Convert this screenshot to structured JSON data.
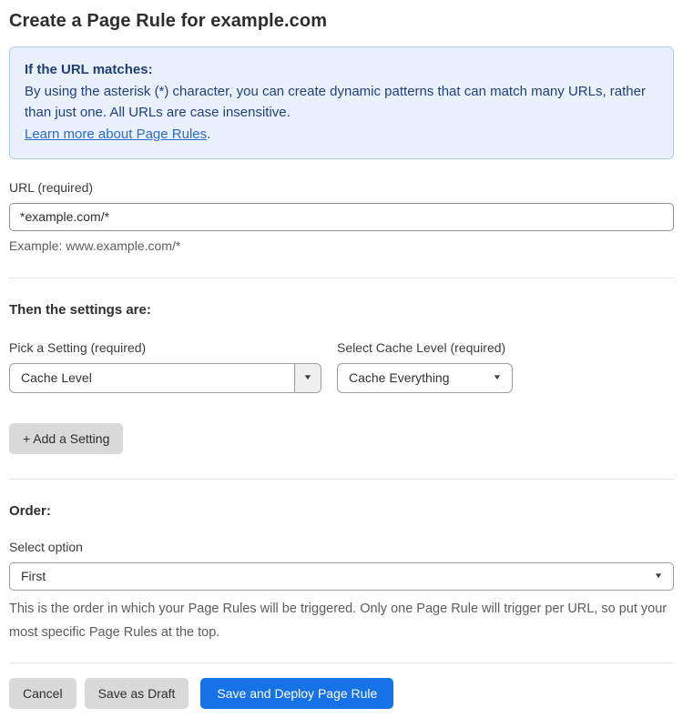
{
  "page": {
    "title": "Create a Page Rule for example.com"
  },
  "info_box": {
    "heading": "If the URL matches:",
    "body": "By using the asterisk (*) character, you can create dynamic patterns that can match many URLs, rather than just one. All URLs are case insensitive.",
    "link_label": "Learn more about Page Rules",
    "link_suffix": "."
  },
  "url_field": {
    "label": "URL (required)",
    "value": "*example.com/*",
    "helper": "Example: www.example.com/*"
  },
  "settings": {
    "heading": "Then the settings are:",
    "setting_picker": {
      "label": "Pick a Setting (required)",
      "selected": "Cache Level"
    },
    "cache_level_picker": {
      "label": "Select Cache Level (required)",
      "selected": "Cache Everything"
    },
    "add_setting_label": "+ Add a Setting"
  },
  "order": {
    "heading": "Order:",
    "select_label": "Select option",
    "selected": "First",
    "helper": "This is the order in which your Page Rules will be triggered. Only one Page Rule will trigger per URL, so put your most specific Page Rules at the top."
  },
  "actions": {
    "cancel": "Cancel",
    "save_draft": "Save as Draft",
    "save_deploy": "Save and Deploy Page Rule"
  },
  "icons": {
    "dropdown_arrow": "▼"
  },
  "colors": {
    "accent_blue": "#1672e6",
    "info_bg": "#e9f1fc",
    "info_border": "#b0cdf1",
    "info_text": "#24407a",
    "link_blue": "#2d6ace",
    "button_gray": "#d9d9d9"
  }
}
